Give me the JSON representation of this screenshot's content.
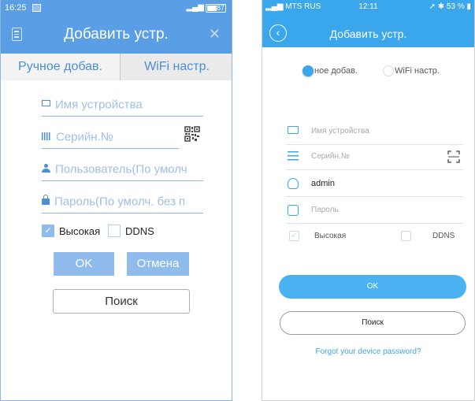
{
  "left": {
    "status": {
      "time": "16:25",
      "signal": "⁀₀₁₂",
      "battery": "87"
    },
    "title": "Добавить устр.",
    "tabs": [
      "Ручное добав.",
      "WiFi настр."
    ],
    "fields": {
      "device_name": "Имя устройства",
      "serial": "Серийн.№",
      "user": "Пользователь(По умолч",
      "password": "Пароль(По умолч. без п"
    },
    "checkboxes": {
      "high": "Высокая",
      "ddns": "DDNS"
    },
    "buttons": {
      "ok": "OK",
      "cancel": "Отмена",
      "search": "Поиск"
    },
    "colors": {
      "accent": "#5a9ee6",
      "button": "#8fbcec"
    }
  },
  "right": {
    "status": {
      "carrier": "MTS RUS",
      "time": "12:11",
      "battery": "53 %"
    },
    "title": "Добавить устр.",
    "radios": [
      "ное добав.",
      "WiFi настр."
    ],
    "fields": {
      "device_name": "Имя устройства",
      "serial": "Серийн.№",
      "user": "admin",
      "password": "Пароль"
    },
    "checkboxes": {
      "high": "Высокая",
      "ddns": "DDNS"
    },
    "buttons": {
      "ok": "OK",
      "search": "Поиск"
    },
    "forgot": "Forgot your device password?",
    "colors": {
      "accent": "#3aa6ec"
    }
  }
}
